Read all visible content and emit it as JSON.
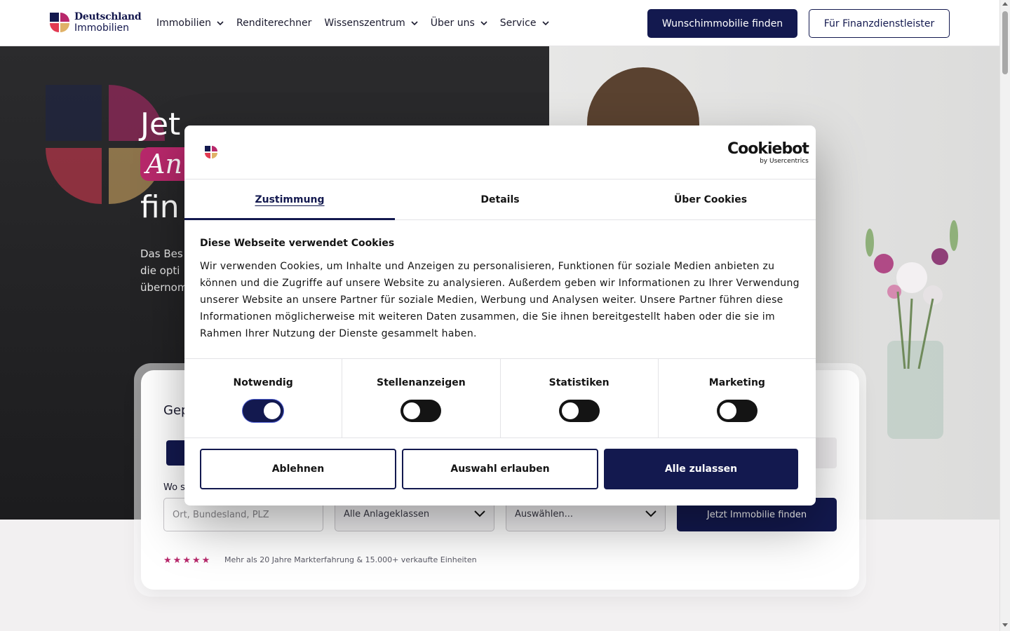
{
  "header": {
    "logo": {
      "line1": "Deutschland",
      "line2": "Immobilien"
    },
    "nav": [
      {
        "label": "Immobilien",
        "has_dropdown": true
      },
      {
        "label": "Renditerechner",
        "has_dropdown": false
      },
      {
        "label": "Wissenszentrum",
        "has_dropdown": true
      },
      {
        "label": "Über uns",
        "has_dropdown": true
      },
      {
        "label": "Service",
        "has_dropdown": true
      }
    ],
    "cta_primary": "Wunschimmobilie finden",
    "cta_secondary": "Für Finanzdienstleister"
  },
  "hero": {
    "heading_line1": "Jet",
    "heading_pill": "An",
    "heading_line3": "fin",
    "subtext": "Das Bes die opti übernom"
  },
  "search": {
    "title": "Gep",
    "where_label": "Wo s",
    "location_placeholder": "Ort, Bundesland, PLZ",
    "asset_class_selected": "Alle Anlageklassen",
    "third_select_selected": "Auswählen...",
    "submit": "Jetzt Immobilie finden",
    "rating_stars": 5,
    "rating_text": "Mehr als 20 Jahre Markterfahrung & 15.000+ verkaufte Einheiten"
  },
  "cookie_dialog": {
    "brand_line1": "Cookiebot",
    "brand_line2": "by Usercentrics",
    "tabs": [
      {
        "label": "Zustimmung",
        "active": true
      },
      {
        "label": "Details",
        "active": false
      },
      {
        "label": "Über Cookies",
        "active": false
      }
    ],
    "title": "Diese Webseite verwendet Cookies",
    "body": "Wir verwenden Cookies, um Inhalte und Anzeigen zu personalisieren, Funktionen für soziale Medien anbieten zu können und die Zugriffe auf unsere Website zu analysieren. Außerdem geben wir Informationen zu Ihrer Verwendung unserer Website an unsere Partner für soziale Medien, Werbung und Analysen weiter. Unsere Partner führen diese Informationen möglicherweise mit weiteren Daten zusammen, die Sie ihnen bereitgestellt haben oder die sie im Rahmen Ihrer Nutzung der Dienste gesammelt haben.",
    "categories": [
      {
        "label": "Notwendig",
        "enabled": true
      },
      {
        "label": "Stellenanzeigen",
        "enabled": false
      },
      {
        "label": "Statistiken",
        "enabled": false
      },
      {
        "label": "Marketing",
        "enabled": false
      }
    ],
    "buttons": {
      "decline": "Ablehnen",
      "allow_selection": "Auswahl erlauben",
      "allow_all": "Alle zulassen"
    }
  },
  "colors": {
    "brand_navy": "#13194f",
    "brand_magenta": "#b8286b",
    "brand_gold": "#e0b267",
    "brand_red": "#e23a52"
  }
}
